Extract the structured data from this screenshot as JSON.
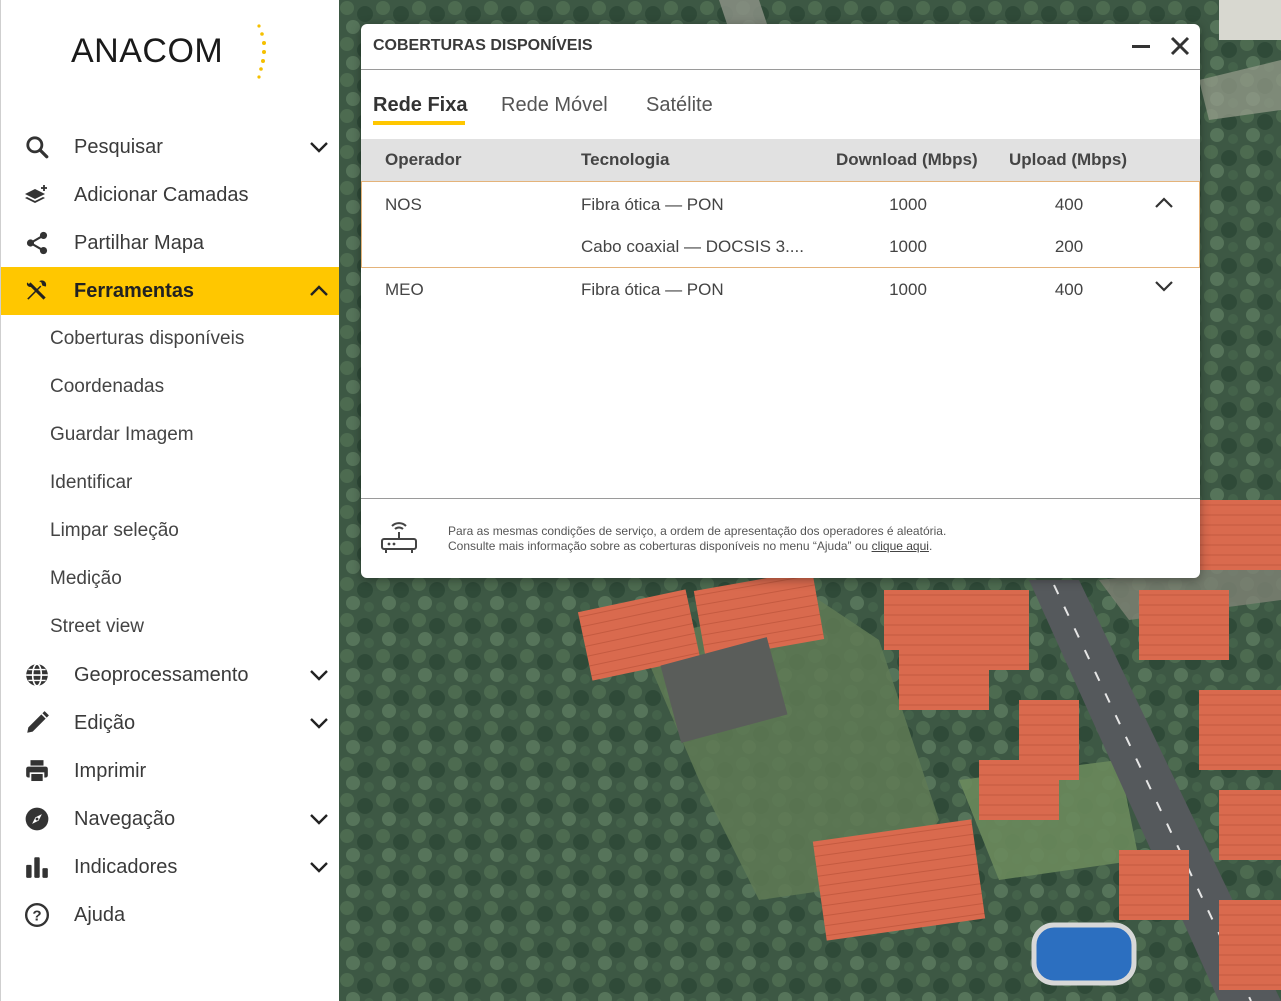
{
  "brand": {
    "logo_text": "ANACOM",
    "accent_color": "#ffc700"
  },
  "sidebar": {
    "items": [
      {
        "label": "Pesquisar",
        "icon": "search-icon",
        "chevron": "down"
      },
      {
        "label": "Adicionar Camadas",
        "icon": "layers-add-icon",
        "chevron": ""
      },
      {
        "label": "Partilhar Mapa",
        "icon": "share-icon",
        "chevron": ""
      },
      {
        "label": "Ferramentas",
        "icon": "tools-icon",
        "chevron": "up",
        "active": true
      },
      {
        "label": "Geoprocessamento",
        "icon": "globe-icon",
        "chevron": "down"
      },
      {
        "label": "Edição",
        "icon": "pencil-icon",
        "chevron": "down"
      },
      {
        "label": "Imprimir",
        "icon": "printer-icon",
        "chevron": ""
      },
      {
        "label": "Navegação",
        "icon": "compass-icon",
        "chevron": "down"
      },
      {
        "label": "Indicadores",
        "icon": "bar-chart-icon",
        "chevron": "down"
      },
      {
        "label": "Ajuda",
        "icon": "help-icon",
        "chevron": ""
      }
    ],
    "ferramentas_subitems": [
      "Coberturas disponíveis",
      "Coordenadas",
      "Guardar Imagem",
      "Identificar",
      "Limpar seleção",
      "Medição",
      "Street view"
    ]
  },
  "dialog": {
    "title": "COBERTURAS DISPONÍVEIS",
    "tabs": [
      {
        "label": "Rede Fixa",
        "active": true
      },
      {
        "label": "Rede Móvel",
        "active": false
      },
      {
        "label": "Satélite",
        "active": false
      }
    ],
    "columns": [
      "Operador",
      "Tecnologia",
      "Download (Mbps)",
      "Upload (Mbps)"
    ],
    "rows": [
      {
        "operator": "NOS",
        "expanded": true,
        "entries": [
          {
            "technology": "Fibra ótica — PON",
            "download": "1000",
            "upload": "400"
          },
          {
            "technology": "Cabo coaxial — DOCSIS 3....",
            "download": "1000",
            "upload": "200"
          }
        ]
      },
      {
        "operator": "MEO",
        "expanded": false,
        "entries": [
          {
            "technology": "Fibra ótica — PON",
            "download": "1000",
            "upload": "400"
          }
        ]
      }
    ],
    "footer": {
      "line1": "Para as mesmas condições de serviço, a ordem de apresentação dos operadores é aleatória.",
      "line2_prefix": "Consulte mais informação sobre as coberturas disponíveis no menu “Ajuda” ou ",
      "link_text": "clique aqui",
      "line2_suffix": "."
    }
  }
}
